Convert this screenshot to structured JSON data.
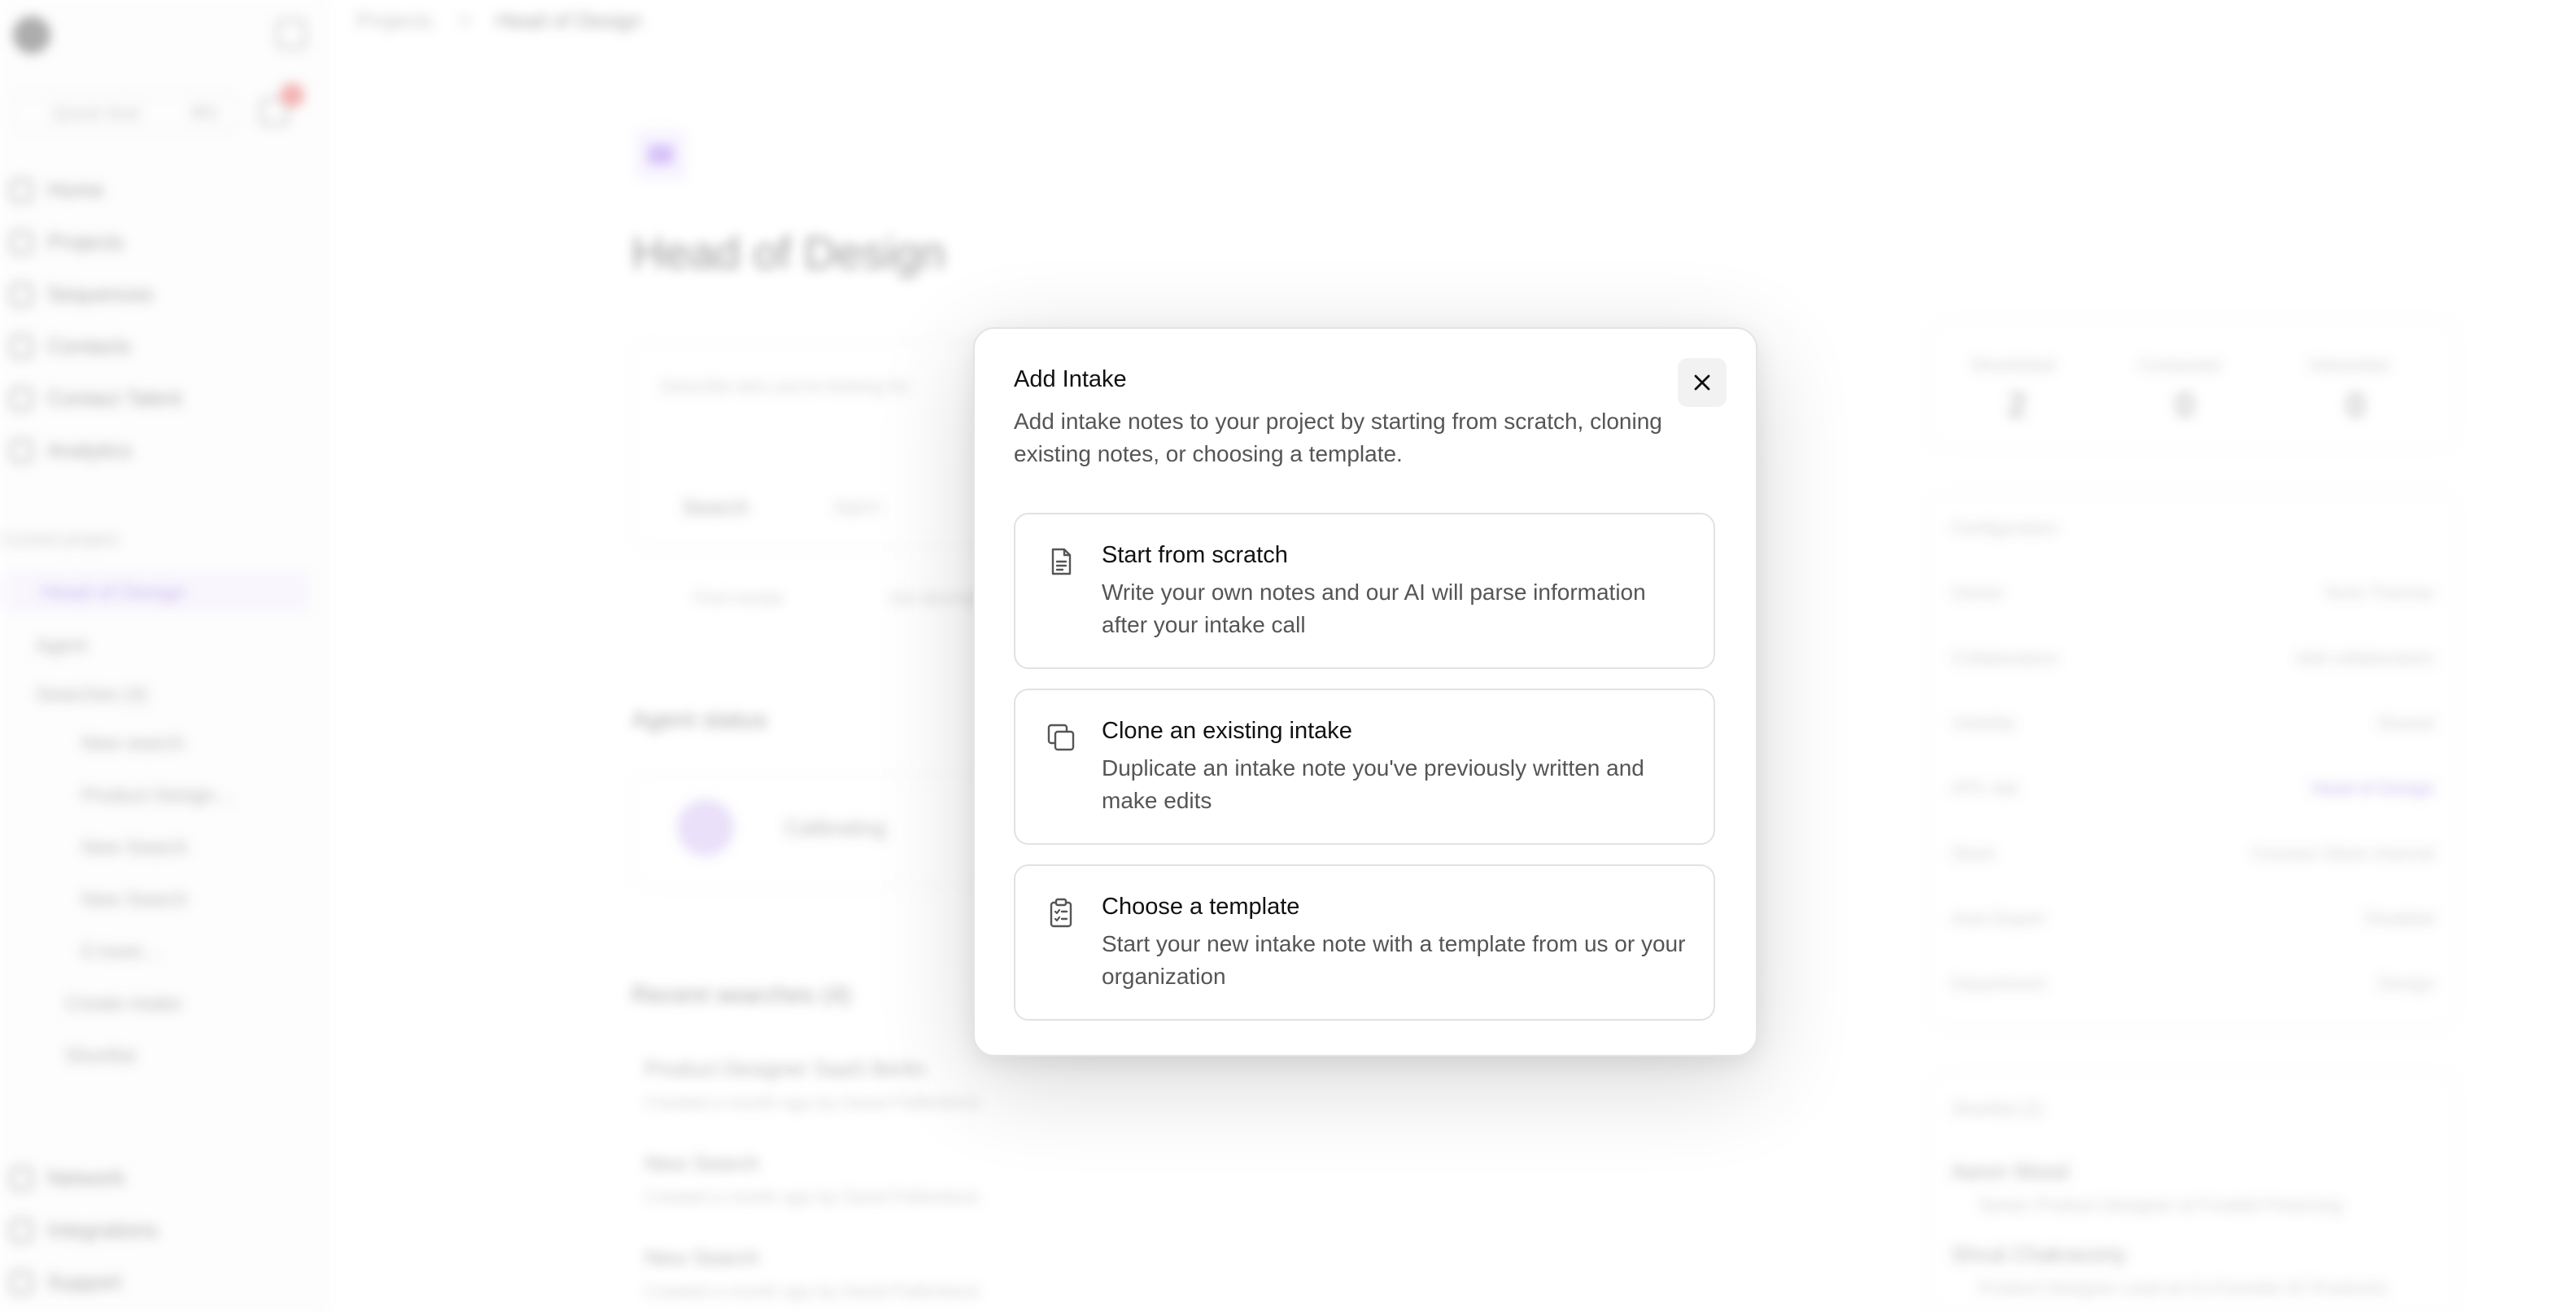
{
  "sidebar": {
    "quick_find": "Quick find",
    "quick_find_kbd": "⌘K",
    "nav": [
      "Home",
      "Projects",
      "Sequences",
      "Contacts",
      "Contact Talent",
      "Analytics"
    ],
    "section_label": "Current project",
    "current_project": "Head of Design",
    "sub_items": [
      "Agent",
      "Searches (4)",
      "New search",
      "Product Design…",
      "New Search",
      "New Search",
      "0 more…",
      "Create intake",
      "Shortlist"
    ],
    "bottom_nav": [
      "Network",
      "Integrations",
      "Support"
    ]
  },
  "header": {
    "breadcrumb_root": "Projects",
    "breadcrumb_separator": ">",
    "breadcrumb_current": "Head of Design"
  },
  "project": {
    "title": "Head of Design",
    "search_placeholder": "Describe who you're looking for",
    "search_tab": "Search",
    "agent_tab": "Agent",
    "find_similar": "Find similar",
    "job_description": "Job description",
    "agent_status_label": "Agent status",
    "agent_status_value": "Calibrating",
    "recent_searches_label": "Recent searches (4)",
    "recent_searches": [
      {
        "title": "Product Designer SaaS Berlin",
        "meta": "Created a month ago by David Palfenkeck"
      },
      {
        "title": "New Search",
        "meta": "Created a month ago by David Palfenkeck"
      },
      {
        "title": "New Search",
        "meta": "Created a month ago by David Palfenkeck"
      }
    ],
    "stats": [
      {
        "label": "Shortlisted",
        "value": "2"
      },
      {
        "label": "Contacted",
        "value": "0"
      },
      {
        "label": "Interested",
        "value": "0"
      }
    ],
    "configuration_label": "Configuration",
    "config": [
      {
        "key": "Owner",
        "value": "Tevin Thomas"
      },
      {
        "key": "Collaborators",
        "value": "Add collaborators"
      },
      {
        "key": "Visibility",
        "value": "Shared"
      },
      {
        "key": "ATS Job",
        "value": "Head of Design"
      },
      {
        "key": "Slack",
        "value": "Connect Slack channel"
      },
      {
        "key": "Auto Export",
        "value": "Disabled"
      },
      {
        "key": "Department",
        "value": "Design"
      }
    ],
    "shortlist_label": "Shortlist (2)",
    "shortlist": [
      {
        "name": "Aaron Wood",
        "role": "Senior Product Designer at Funded Financing"
      },
      {
        "name": "Shruti Chakravorty",
        "role": "Product Designer Lead at Co-Founder (K Products)"
      }
    ]
  },
  "modal": {
    "title": "Add Intake",
    "description": "Add intake notes to your project by starting from scratch, cloning existing notes, or choosing a template.",
    "close_icon": "close-icon",
    "options": [
      {
        "title": "Start from scratch",
        "description": "Write your own notes and our AI will parse information after your intake call",
        "icon": "document-icon"
      },
      {
        "title": "Clone an existing intake",
        "description": "Duplicate an intake note you've previously written and make edits",
        "icon": "copy-icon"
      },
      {
        "title": "Choose a template",
        "description": "Start your new intake note with a template from us or your organization",
        "icon": "clipboard-list-icon"
      }
    ]
  },
  "colors": {
    "accent": "#9b6cf0",
    "badge": "#e54848",
    "text_primary": "#111111",
    "text_secondary": "#555555",
    "border": "#e2e2e2"
  }
}
